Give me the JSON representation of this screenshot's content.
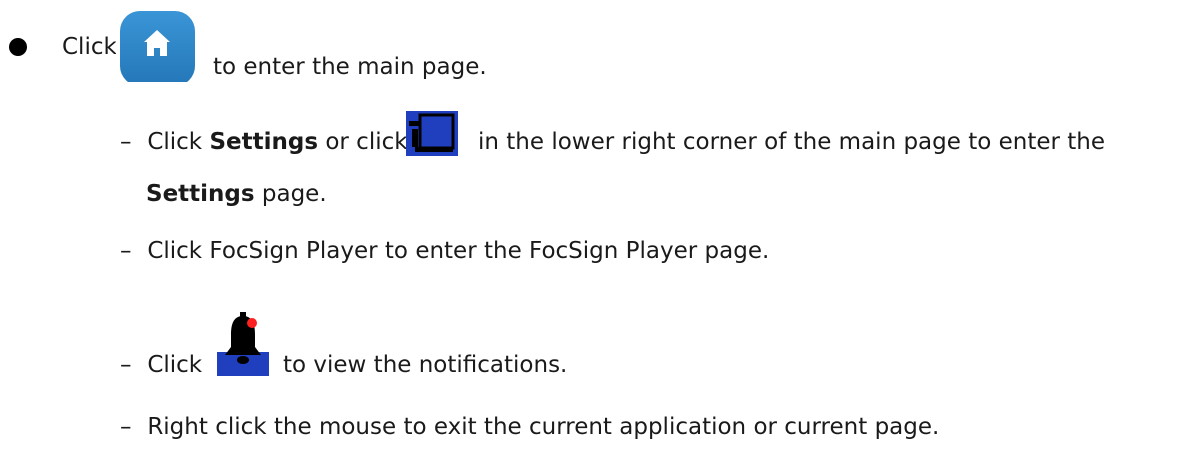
{
  "bullet": {
    "click_word": "Click",
    "after_icon": "to enter the main page."
  },
  "items": [
    {
      "dash": "–",
      "click_word": "Click",
      "bold_settings": "Settings",
      "or_click": "or click",
      "after_icon": "in the lower right corner of the main page to enter the",
      "cont_bold": "Settings",
      "cont_after": "page."
    },
    {
      "dash": "–",
      "text": "Click FocSign Player to enter the FocSign Player page."
    },
    {
      "dash": "–",
      "click_word": "Click",
      "after_icon": "to view the notifications."
    },
    {
      "dash": "–",
      "text": "Right click the mouse to exit the current application or current page."
    }
  ],
  "icons": {
    "home": "home-icon",
    "settings": "settings-panel-icon",
    "bell": "notification-bell-icon"
  },
  "colors": {
    "home_icon_bg": "#2f86c8",
    "settings_icon_bg": "#1f3fbf",
    "bell_icon_bg": "#1f3fbf",
    "bell_dot": "#ff2020"
  }
}
